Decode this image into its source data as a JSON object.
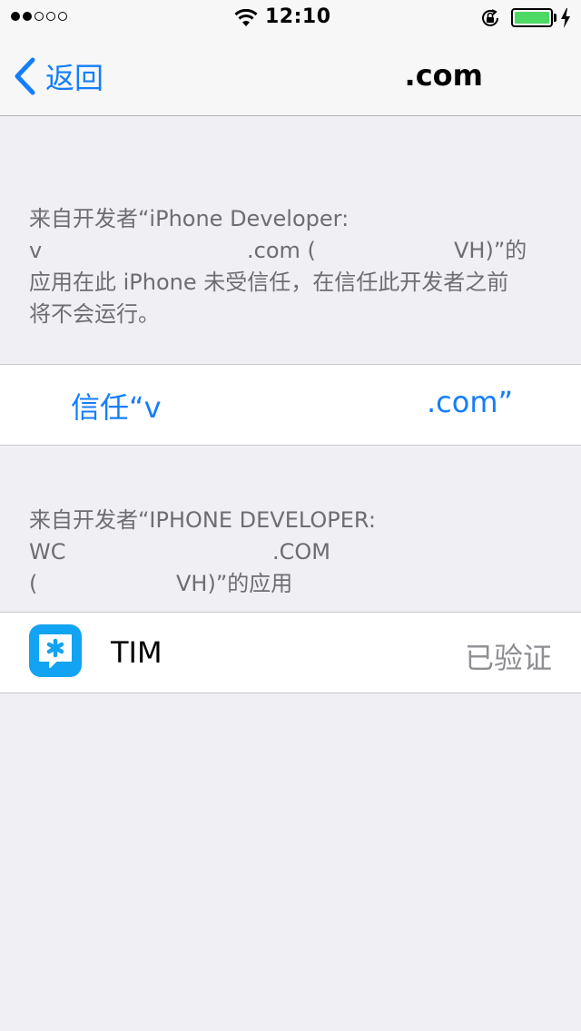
{
  "status_bar": {
    "time": "12:10",
    "signal_dots_filled": 2,
    "signal_dots_total": 5,
    "battery_level": 1.0,
    "battery_color": "#4cd964"
  },
  "nav": {
    "back_label": "返回",
    "title": ".com",
    "accent_color": "#147efb"
  },
  "section1": {
    "footer_line1": "来自开发者“iPhone Developer:",
    "footer_line2_a": "v",
    "footer_line2_b": ".com (",
    "footer_line2_c": "VH)”的",
    "footer_line3": "应用在此 iPhone 未受信任，在信任此开发者之前",
    "footer_line4": "将不会运行。",
    "trust_button_start": "信任“v",
    "trust_button_end": ".com”"
  },
  "section2": {
    "header_line1": "来自开发者“IPHONE DEVELOPER:",
    "header_line2_a": "WC",
    "header_line2_b": ".COM",
    "header_line3_a": "(",
    "header_line3_b": "VH)”的应用",
    "app": {
      "name": "TIM",
      "status": "已验证",
      "icon": "tim-app-icon"
    }
  }
}
